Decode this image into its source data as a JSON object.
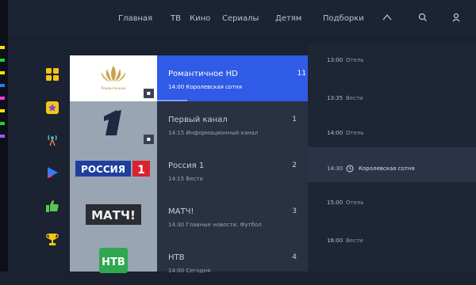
{
  "nav": {
    "items": [
      "Главная",
      "ТВ",
      "Кино",
      "Сериалы",
      "Детям",
      "Подборки"
    ],
    "icons": [
      "tv-program-icon",
      "search-icon",
      "profile-icon"
    ]
  },
  "categories": [
    {
      "icon": "grid-icon",
      "color": "#f5c518"
    },
    {
      "icon": "favorites-star-icon",
      "color": "#f5c518"
    },
    {
      "icon": "broadcast-icon",
      "color": "#4fd1c5"
    },
    {
      "icon": "cinema-play-icon",
      "color": "#2f7bff"
    },
    {
      "icon": "thumbs-up-icon",
      "color": "#57c84d"
    },
    {
      "icon": "trophy-icon",
      "color": "#f5c518"
    }
  ],
  "channels": [
    {
      "name": "Романтичное HD",
      "number": "11",
      "program": "14:00 Королевская сотня",
      "logo": "Романтичное",
      "badge": "▪",
      "progress": 0.2
    },
    {
      "name": "Первый канал",
      "number": "1",
      "program": "14:15 Информационный канал",
      "logo": "1",
      "badge": "▪"
    },
    {
      "name": "Россия 1",
      "number": "2",
      "program": "14:15 Вести",
      "logo": "РОССИЯ 1"
    },
    {
      "name": "МАТЧ!",
      "number": "3",
      "program": "14:30 Главные новости. Футбол",
      "logo": "МАТЧ!"
    },
    {
      "name": "НТВ",
      "number": "4",
      "program": "14:00 Сегодня",
      "logo": "НТВ"
    }
  ],
  "schedule": [
    {
      "time": "13:00",
      "title": "Отель"
    },
    {
      "time": "13:35",
      "title": "Вести"
    },
    {
      "time": "14:00",
      "title": "Отель"
    },
    {
      "time": "14:30",
      "title": "Королевская сотня",
      "live": true
    },
    {
      "time": "15:00",
      "title": "Отель"
    },
    {
      "time": "16:00",
      "title": "Вести"
    }
  ]
}
